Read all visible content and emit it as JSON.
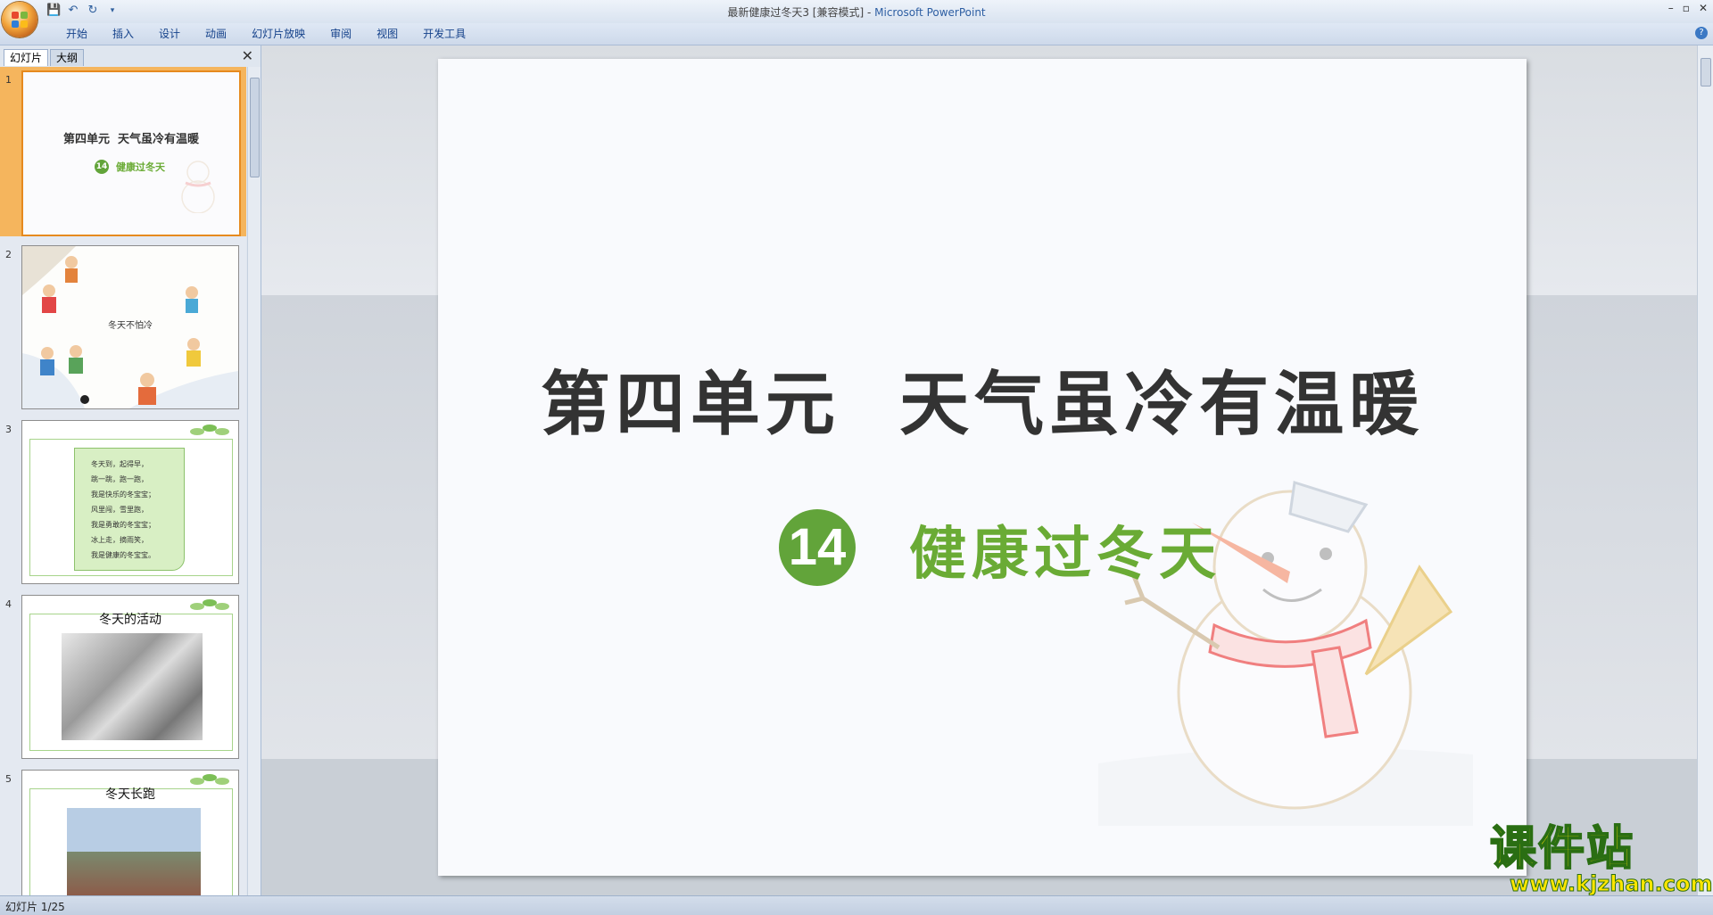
{
  "window": {
    "title_doc": "最新健康过冬天3 [兼容模式]",
    "title_sep": " - ",
    "title_app": "Microsoft PowerPoint"
  },
  "ribbon": {
    "tabs": [
      "开始",
      "插入",
      "设计",
      "动画",
      "幻灯片放映",
      "审阅",
      "视图",
      "开发工具"
    ]
  },
  "slide_panel": {
    "tab_slides": "幻灯片",
    "tab_outline": "大纲",
    "thumbs": [
      {
        "num": "1",
        "title": "第四单元  天气虽冷有温暖",
        "badge": "14",
        "subtitle": "健康过冬天"
      },
      {
        "num": "2",
        "text": "冬天不怕冷"
      },
      {
        "num": "3",
        "lines": [
          "冬天到，起得早，",
          "跳一跳，跑一跑，",
          "我是快乐的冬宝宝；",
          "风里闯，雪里跑，",
          "我是勇敢的冬宝宝；",
          "冰上走，摘雨笑，",
          "我是健康的冬宝宝。"
        ]
      },
      {
        "num": "4",
        "caption": "冬天的活动"
      },
      {
        "num": "5",
        "caption": "冬天长跑"
      }
    ]
  },
  "slide": {
    "title": "第四单元  天气虽冷有温暖",
    "number": "14",
    "subtitle": "健康过冬天"
  },
  "status": {
    "slide_info": "幻灯片 1/25"
  },
  "watermark": {
    "brand": "课件站",
    "url": "www.kjzhan.com"
  },
  "colors": {
    "accent_green": "#62a43a",
    "selection_orange": "#f5b55d",
    "watermark_yellow": "#ffe600"
  }
}
